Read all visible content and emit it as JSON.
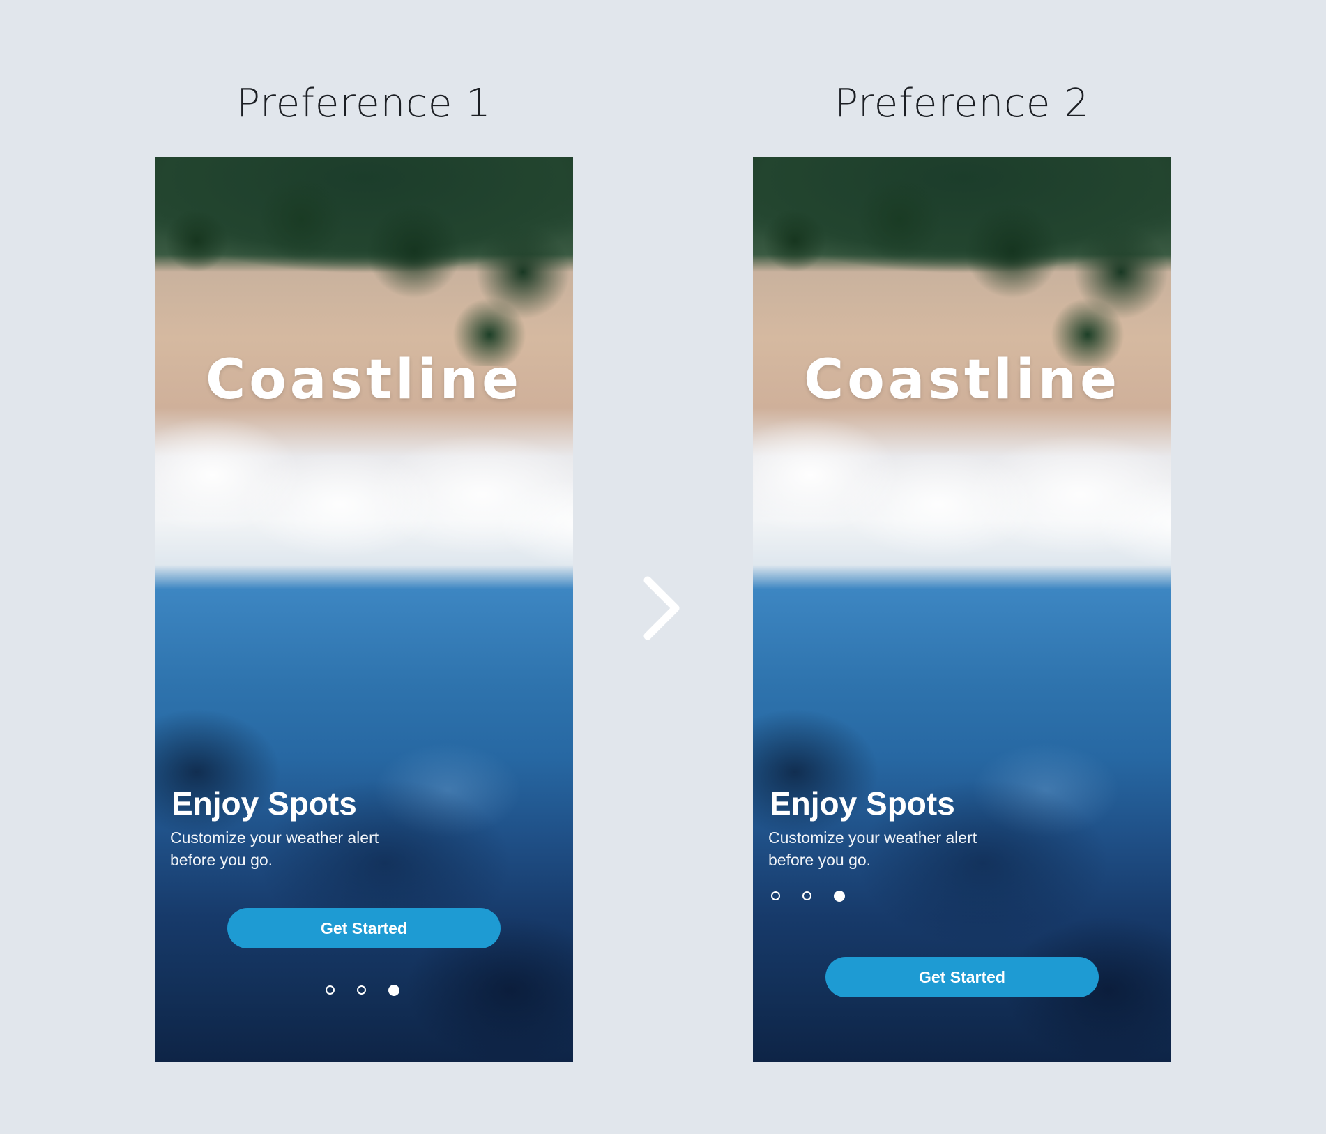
{
  "comparison": {
    "left_title": "Preference 1",
    "right_title": "Preference 2",
    "next_icon": "chevron-right-icon"
  },
  "screens": [
    {
      "brand": "Coastline",
      "headline": "Enjoy Spots",
      "subtext_line1": "Customize your weather alert",
      "subtext_line2": "before you go.",
      "cta_label": "Get Started",
      "pagination": {
        "total": 3,
        "active_index": 2
      }
    },
    {
      "brand": "Coastline",
      "headline": "Enjoy Spots",
      "subtext_line1": "Customize your weather alert",
      "subtext_line2": "before you go.",
      "cta_label": "Get Started",
      "pagination": {
        "total": 3,
        "active_index": 2
      }
    }
  ],
  "colors": {
    "page_background": "#e1e6ec",
    "button": "#1e9bd3",
    "text_light": "#ffffff",
    "title_dark": "#1c1f24"
  }
}
